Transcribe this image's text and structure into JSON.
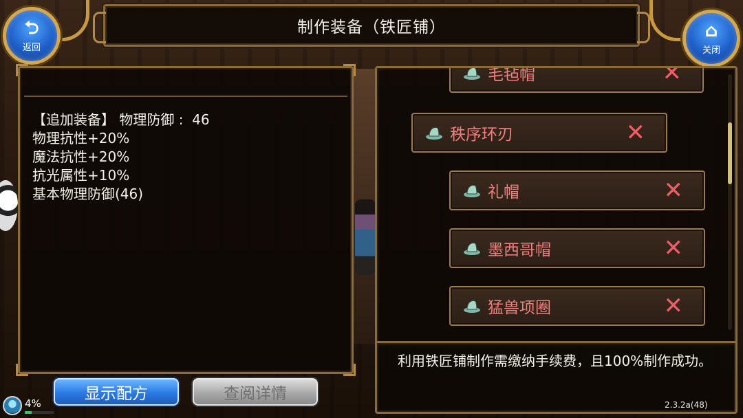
{
  "header": {
    "title": "制作装备（铁匠铺）"
  },
  "back_button": {
    "icon": "return-arrow-icon",
    "label": "返回"
  },
  "close_button": {
    "icon": "home-icon",
    "label": "关闭"
  },
  "details": {
    "lines": [
      "【追加装备】 物理防御 :  46",
      "物理抗性+20%",
      "魔法抗性+20%",
      "抗光属性+10%",
      "基本物理防御(46)"
    ]
  },
  "buttons": {
    "show_recipe": "显示配方",
    "view_details": "查阅详情"
  },
  "status": {
    "percent_label": "4%",
    "progress": 0.04
  },
  "recipes": {
    "items": [
      {
        "name": "毛毡帽",
        "icon": "hat-icon",
        "remove": "✕"
      },
      {
        "name": "秩序环刃",
        "icon": "hat-icon",
        "remove": "✕"
      },
      {
        "name": "礼帽",
        "icon": "hat-icon",
        "remove": "✕"
      },
      {
        "name": "墨西哥帽",
        "icon": "hat-icon",
        "remove": "✕"
      },
      {
        "name": "猛兽项圈",
        "icon": "hat-icon",
        "remove": "✕"
      }
    ],
    "colors": {
      "item_name": "#f07f7f",
      "remove_x": "#ef5d67"
    }
  },
  "notice": {
    "text": "利用铁匠铺制作需缴纳手续费，且100%制作成功。"
  },
  "version": "2.3.2a(48)"
}
